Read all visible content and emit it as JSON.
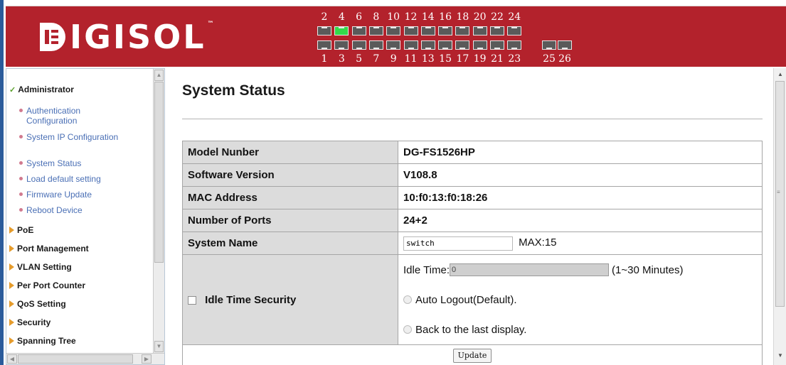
{
  "brand": {
    "name": "IGISOL",
    "tm": "™"
  },
  "ports": {
    "top_labels": [
      "2",
      "4",
      "6",
      "8",
      "10",
      "12",
      "14",
      "16",
      "18",
      "20",
      "22",
      "24"
    ],
    "bottom_labels": [
      "1",
      "3",
      "5",
      "7",
      "9",
      "11",
      "13",
      "15",
      "17",
      "19",
      "21",
      "23"
    ],
    "uplink_labels": [
      "25",
      "26"
    ],
    "active_port": "4"
  },
  "sidebar": {
    "groups": [
      {
        "label": "Administrator",
        "expanded": true,
        "items": [
          "Authentication Configuration",
          "System IP Configuration",
          "System Status",
          "Load default setting",
          "Firmware Update",
          "Reboot Device"
        ]
      },
      {
        "label": "PoE"
      },
      {
        "label": "Port Management"
      },
      {
        "label": "VLAN Setting"
      },
      {
        "label": "Per Port Counter"
      },
      {
        "label": "QoS Setting"
      },
      {
        "label": "Security"
      },
      {
        "label": "Spanning Tree"
      }
    ]
  },
  "main": {
    "title": "System Status",
    "rows": [
      {
        "label": "Model Nunber",
        "value": "DG-FS1526HP"
      },
      {
        "label": "Software Version",
        "value": "V108.8"
      },
      {
        "label": "MAC Address",
        "value": "10:f0:13:f0:18:26"
      },
      {
        "label": "Number of Ports",
        "value": "24+2"
      }
    ],
    "system_name": {
      "label": "System Name",
      "value": "switch",
      "max": "MAX:15"
    },
    "idle": {
      "label": "Idle Time Security",
      "time_label": "Idle Time:",
      "time_value": "0",
      "range": "(1~30 Minutes)",
      "option1": "Auto Logout(Default).",
      "option2": "Back to the last display."
    },
    "update_label": "Update"
  },
  "colors": {
    "header": "#b3222c",
    "active_port": "#33d94a",
    "link": "#4a6fb5",
    "label_bg": "#dcdcdc"
  }
}
